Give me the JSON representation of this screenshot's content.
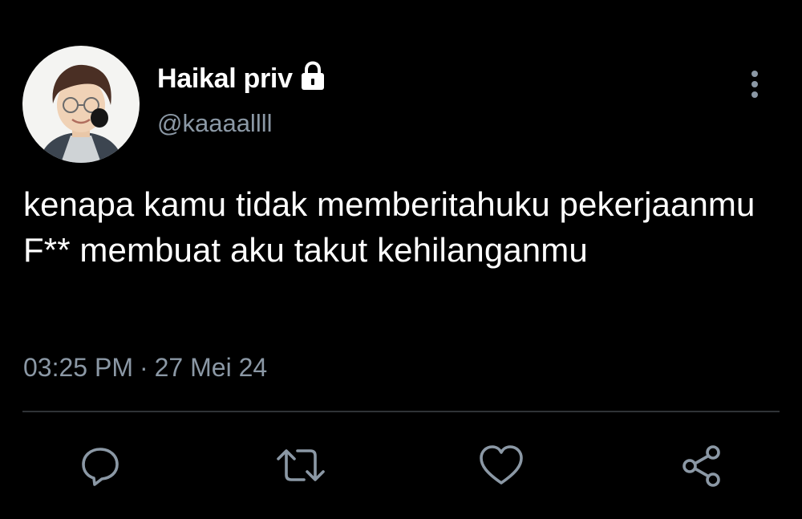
{
  "tweet": {
    "author": {
      "display_name": "Haikal priv",
      "handle": "@kaaaallll",
      "protected_icon": "lock-icon",
      "avatar": "profile-photo"
    },
    "text": "kenapa kamu tidak memberitahuku pekerjaanmu F** membuat aku takut kehilanganmu",
    "time": "03:25 PM",
    "separator": "·",
    "date": "27 Mei 24",
    "more_icon": "more-vertical-icon"
  },
  "actions": [
    {
      "name": "reply",
      "icon": "reply-icon"
    },
    {
      "name": "retweet",
      "icon": "retweet-icon"
    },
    {
      "name": "like",
      "icon": "heart-icon"
    },
    {
      "name": "share",
      "icon": "share-icon"
    }
  ],
  "colors": {
    "background": "#000000",
    "primary_text": "#ffffff",
    "secondary_text": "#8b98a5",
    "icon": "#8b98a5",
    "divider": "#2f3336"
  }
}
